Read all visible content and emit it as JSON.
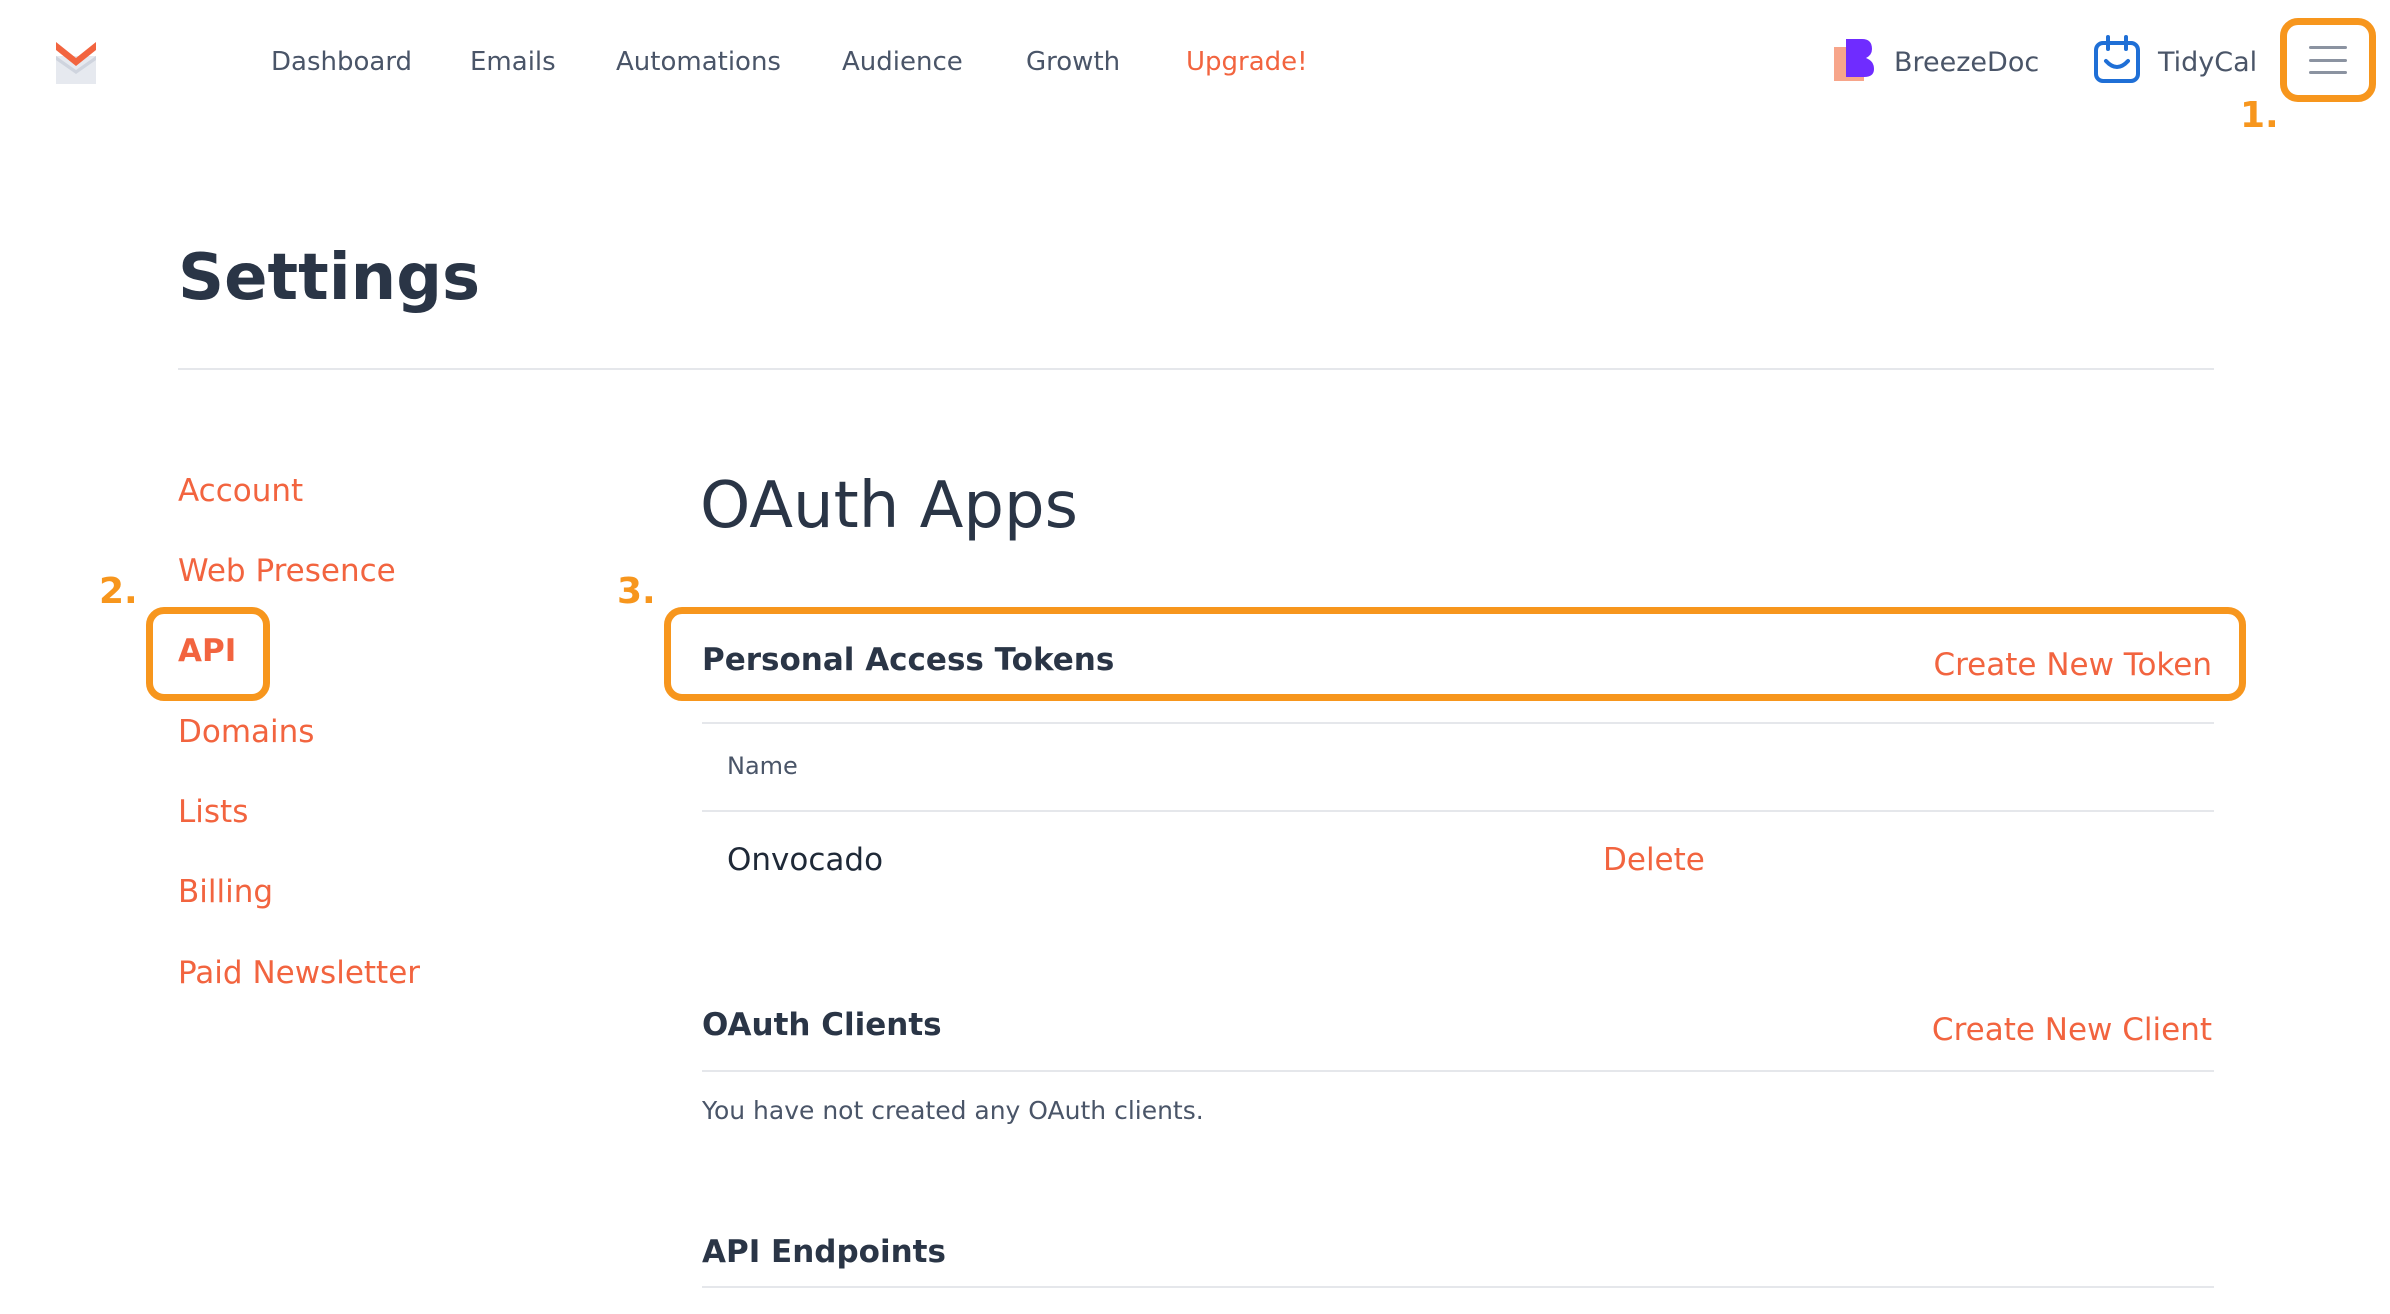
{
  "brand": {
    "logo_icon": "mailbox-envelope-logo",
    "accent_color": "#f2643f",
    "annotation_color": "#f7961d"
  },
  "nav": {
    "items": [
      {
        "label": "Dashboard"
      },
      {
        "label": "Emails"
      },
      {
        "label": "Automations"
      },
      {
        "label": "Audience"
      },
      {
        "label": "Growth"
      },
      {
        "label": "Upgrade!"
      }
    ],
    "apps": [
      {
        "label": "BreezeDoc",
        "icon": "breezedoc-icon"
      },
      {
        "label": "TidyCal",
        "icon": "tidycal-icon"
      }
    ],
    "menu_icon": "hamburger-menu-icon"
  },
  "annotations": {
    "step1": "1.",
    "step2": "2.",
    "step3": "3."
  },
  "settings": {
    "title": "Settings"
  },
  "sidebar": {
    "items": [
      {
        "label": "Account"
      },
      {
        "label": "Web Presence"
      },
      {
        "label": "API"
      },
      {
        "label": "Domains"
      },
      {
        "label": "Lists"
      },
      {
        "label": "Billing"
      },
      {
        "label": "Paid Newsletter"
      }
    ],
    "active": "API"
  },
  "main": {
    "title": "OAuth Apps",
    "tokens": {
      "heading": "Personal Access Tokens",
      "action": "Create New Token",
      "columns": [
        "Name"
      ],
      "rows": [
        {
          "name": "Onvocado",
          "action": "Delete"
        }
      ]
    },
    "clients": {
      "heading": "OAuth Clients",
      "action": "Create New Client",
      "empty": "You have not created any OAuth clients."
    },
    "endpoints": {
      "heading": "API Endpoints"
    }
  }
}
